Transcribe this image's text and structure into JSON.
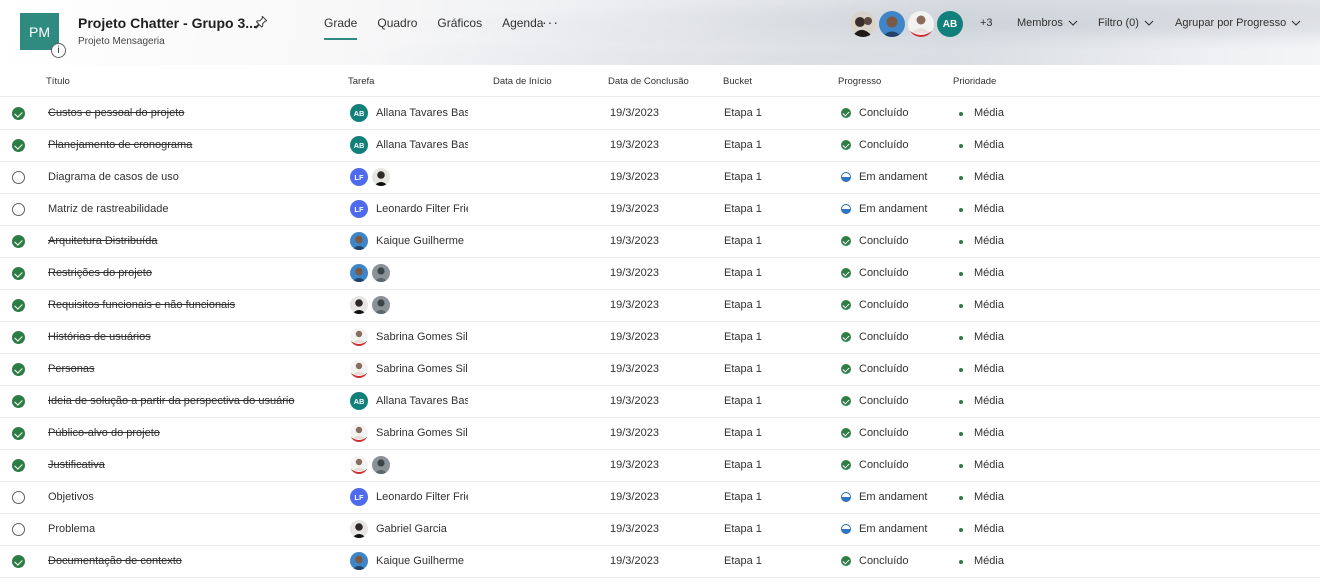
{
  "header": {
    "plan_icon": "PM",
    "info_badge": "i",
    "title": "Projeto Chatter - Grupo 3...",
    "subtitle": "Projeto Mensageria",
    "tabs": [
      "Grade",
      "Quadro",
      "Gráficos",
      "Agenda"
    ],
    "active_tab": "Grade",
    "more": "···",
    "member_initials": "AB",
    "extra_members": "+3",
    "members_label": "Membros",
    "filter_label": "Filtro (0)",
    "group_label": "Agrupar por Progresso"
  },
  "columns": {
    "title": "Título",
    "task": "Tarefa",
    "start": "Data de Início",
    "due": "Data de Conclusão",
    "bucket": "Bucket",
    "progress": "Progresso",
    "priority": "Prioridade"
  },
  "colors": {
    "accent": "#2f8a80",
    "done_green": "#2e7d46",
    "in_progress_blue": "#2b78c8",
    "avatar_ab": "#11807a",
    "avatar_lf": "#4f6bed"
  },
  "tasks": [
    {
      "title": "Custos e pessoal do projeto",
      "done": true,
      "assignees": [
        "AB"
      ],
      "assignee_name": "Allana Tavares Bast",
      "due": "19/3/2023",
      "bucket": "Etapa 1",
      "progress": "Concluído",
      "priority": "Média"
    },
    {
      "title": "Planejamento de cronograma",
      "done": true,
      "assignees": [
        "AB"
      ],
      "assignee_name": "Allana Tavares Bast",
      "due": "19/3/2023",
      "bucket": "Etapa 1",
      "progress": "Concluído",
      "priority": "Média"
    },
    {
      "title": "Diagrama de casos de uso",
      "done": false,
      "assignees": [
        "LF",
        "photo-gabriel"
      ],
      "assignee_name": "",
      "due": "19/3/2023",
      "bucket": "Etapa 1",
      "progress": "Em andament",
      "priority": "Média"
    },
    {
      "title": "Matriz de rastreabilidade",
      "done": false,
      "assignees": [
        "LF"
      ],
      "assignee_name": "Leonardo Filter Frie",
      "due": "19/3/2023",
      "bucket": "Etapa 1",
      "progress": "Em andament",
      "priority": "Média"
    },
    {
      "title": "Arquitetura Distribuída",
      "done": true,
      "assignees": [
        "photo-kaique"
      ],
      "assignee_name": "Kaique Guilherme",
      "due": "19/3/2023",
      "bucket": "Etapa 1",
      "progress": "Concluído",
      "priority": "Média"
    },
    {
      "title": "Restrições do projeto",
      "done": true,
      "assignees": [
        "photo-kaique",
        "photo-grey"
      ],
      "assignee_name": "",
      "due": "19/3/2023",
      "bucket": "Etapa 1",
      "progress": "Concluído",
      "priority": "Média"
    },
    {
      "title": "Requisitos funcionais e não funcionais",
      "done": true,
      "assignees": [
        "photo-gabriel",
        "photo-grey"
      ],
      "assignee_name": "",
      "due": "19/3/2023",
      "bucket": "Etapa 1",
      "progress": "Concluído",
      "priority": "Média"
    },
    {
      "title": "Histórias de usuários",
      "done": true,
      "assignees": [
        "photo-sabrina"
      ],
      "assignee_name": "Sabrina Gomes Silv",
      "due": "19/3/2023",
      "bucket": "Etapa 1",
      "progress": "Concluído",
      "priority": "Média"
    },
    {
      "title": "Personas",
      "done": true,
      "assignees": [
        "photo-sabrina"
      ],
      "assignee_name": "Sabrina Gomes Silv",
      "due": "19/3/2023",
      "bucket": "Etapa 1",
      "progress": "Concluído",
      "priority": "Média"
    },
    {
      "title": "Ideia de solução a partir da perspectiva do usuário",
      "done": true,
      "assignees": [
        "AB"
      ],
      "assignee_name": "Allana Tavares Bast",
      "due": "19/3/2023",
      "bucket": "Etapa 1",
      "progress": "Concluído",
      "priority": "Média"
    },
    {
      "title": "Público-alvo do projeto",
      "done": true,
      "assignees": [
        "photo-sabrina"
      ],
      "assignee_name": "Sabrina Gomes Silv",
      "due": "19/3/2023",
      "bucket": "Etapa 1",
      "progress": "Concluído",
      "priority": "Média"
    },
    {
      "title": "Justificativa",
      "done": true,
      "assignees": [
        "photo-sabrina",
        "photo-grey"
      ],
      "assignee_name": "",
      "due": "19/3/2023",
      "bucket": "Etapa 1",
      "progress": "Concluído",
      "priority": "Média"
    },
    {
      "title": "Objetivos",
      "done": false,
      "assignees": [
        "LF"
      ],
      "assignee_name": "Leonardo Filter Frie",
      "due": "19/3/2023",
      "bucket": "Etapa 1",
      "progress": "Em andament",
      "priority": "Média"
    },
    {
      "title": "Problema",
      "done": false,
      "assignees": [
        "photo-gabriel"
      ],
      "assignee_name": "Gabriel Garcia",
      "due": "19/3/2023",
      "bucket": "Etapa 1",
      "progress": "Em andament",
      "priority": "Média"
    },
    {
      "title": "Documentação de contexto",
      "done": true,
      "assignees": [
        "photo-kaique"
      ],
      "assignee_name": "Kaique Guilherme",
      "due": "19/3/2023",
      "bucket": "Etapa 1",
      "progress": "Concluído",
      "priority": "Média"
    }
  ]
}
